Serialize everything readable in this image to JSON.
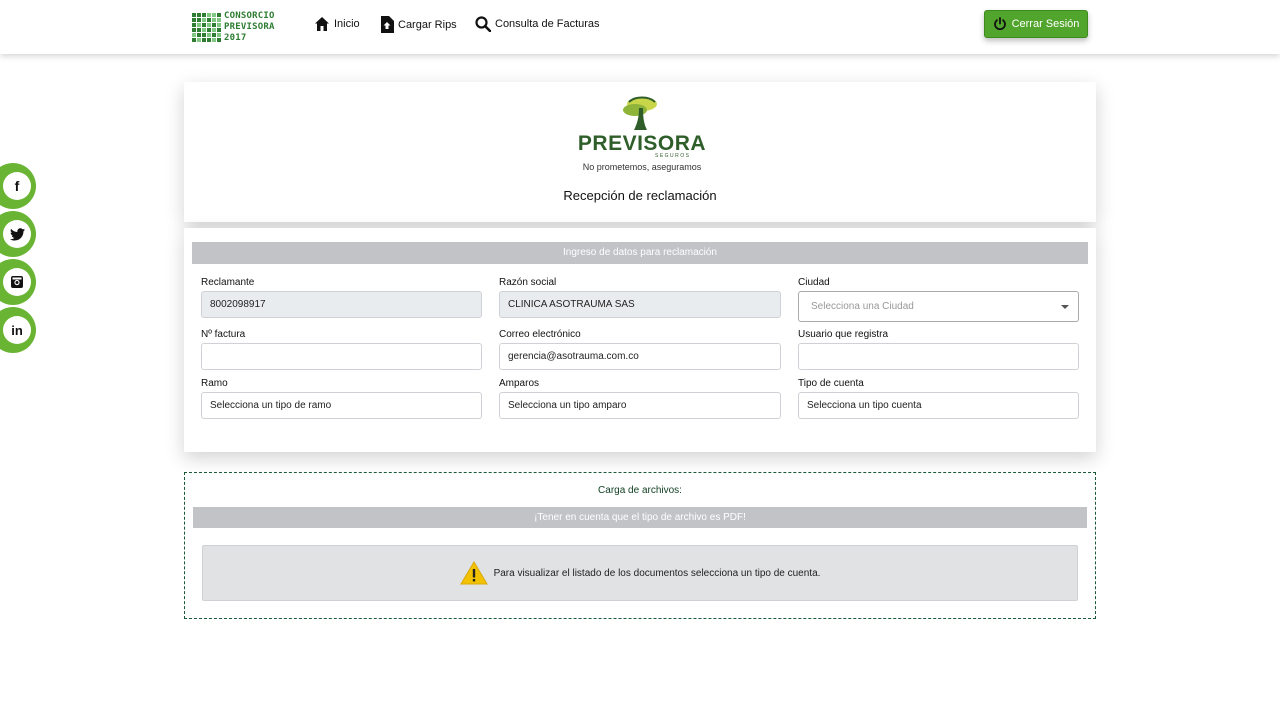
{
  "brand": {
    "line1": "CONSORCIO",
    "line2": "PREVISORA",
    "line3": "2017"
  },
  "nav": {
    "home_label": "Inicio",
    "upload_label": "Cargar Rips",
    "invoices_label": "Consulta de Facturas",
    "logout_label": "Cerrar Sesión"
  },
  "social": {
    "facebook": "f",
    "twitter": "t",
    "instagram": "ig",
    "linkedin": "in"
  },
  "header": {
    "logo_word": "PREVISORA",
    "logo_sub": "SEGUROS",
    "logo_slogan": "No prometemos, aseguramos",
    "title": "Recepción de reclamación"
  },
  "form": {
    "section_title": "Ingreso de datos para reclamación",
    "reclamante": {
      "label": "Reclamante",
      "value": "8002098917"
    },
    "razon_social": {
      "label": "Razón social",
      "value": "CLINICA ASOTRAUMA SAS"
    },
    "ciudad": {
      "label": "Ciudad",
      "placeholder": "Selecciona una Ciudad"
    },
    "factura": {
      "label": "Nº factura",
      "value": ""
    },
    "correo": {
      "label": "Correo electrónico",
      "value": "gerencia@asotrauma.com.co"
    },
    "usuario": {
      "label": "Usuario que registra",
      "value": ""
    },
    "ramo": {
      "label": "Ramo",
      "value": "Selecciona un tipo de ramo"
    },
    "amparos": {
      "label": "Amparos",
      "value": "Selecciona un tipo amparo"
    },
    "tipo_cuenta": {
      "label": "Tipo de cuenta",
      "value": "Selecciona un tipo cuenta"
    }
  },
  "files": {
    "title": "Carga de archivos:",
    "warning_bar": "¡Tener en cuenta que el tipo de archivo es PDF!",
    "notice": "Para visualizar el listado de los documentos selecciona un tipo de cuenta."
  },
  "colors": {
    "accent_green": "#52a52c",
    "social_green": "#6ab434",
    "bar_gray": "#c2c3c7",
    "warning_yellow": "#f2c200"
  }
}
